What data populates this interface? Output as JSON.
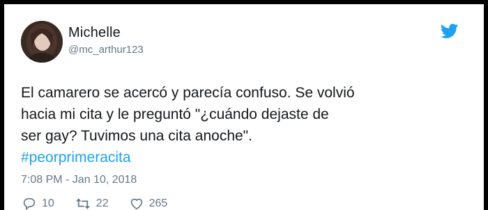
{
  "tweet": {
    "author_name": "Michelle",
    "author_handle": "@mc_arthur123",
    "text_lines": [
      "El camarero se acercó y parecía confuso. Se volvió",
      "hacia mi cita y le preguntó \"¿cuándo dejaste de",
      "ser gay? Tuvimos una cita anoche\"."
    ],
    "hashtag": "#peorprimeracita",
    "timestamp": "7:08 PM - Jan 10, 2018",
    "reply_count": "10",
    "retweet_count": "22",
    "like_count": "265"
  },
  "icons": {
    "brand": "twitter-bird-icon",
    "reply": "reply-icon",
    "retweet": "retweet-icon",
    "like": "heart-icon"
  },
  "colors": {
    "frame": "#000000",
    "card": "#ffffff",
    "text": "#14171a",
    "muted": "#657786",
    "brand": "#1da1f2"
  }
}
